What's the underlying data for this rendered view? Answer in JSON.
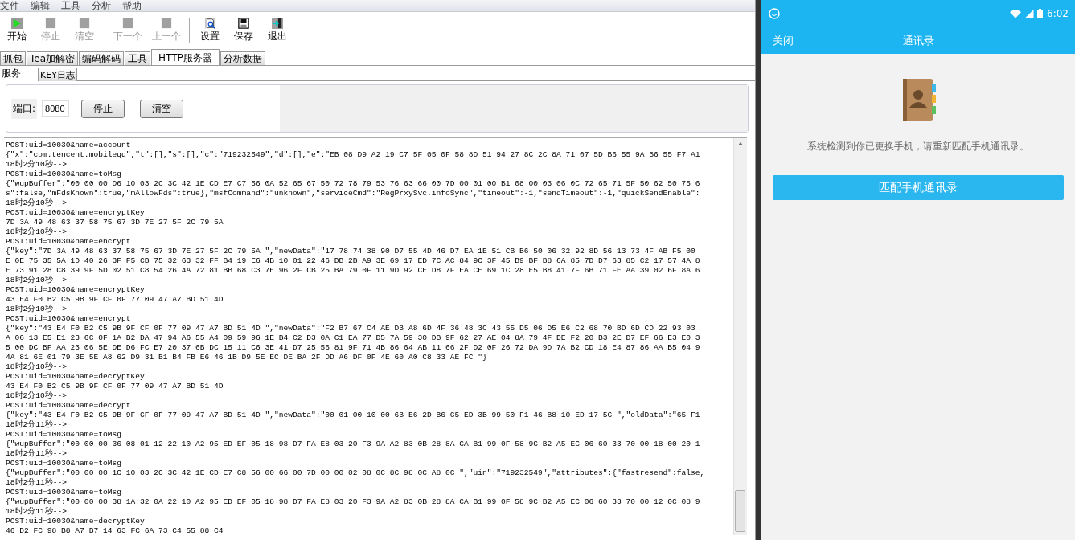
{
  "menu": [
    "文件",
    "编辑",
    "工具",
    "分析",
    "帮助"
  ],
  "toolbar": {
    "groups": [
      [
        {
          "label": "开始",
          "disabled": false
        },
        {
          "label": "停止",
          "disabled": true
        },
        {
          "label": "清空",
          "disabled": true
        }
      ],
      [
        {
          "label": "下一个",
          "disabled": true
        },
        {
          "label": "上一个",
          "disabled": true
        }
      ],
      [
        {
          "label": "设置",
          "disabled": false
        },
        {
          "label": "保存",
          "disabled": false
        },
        {
          "label": "退出",
          "disabled": false
        }
      ]
    ]
  },
  "tabs": [
    {
      "label": "抓包",
      "selected": false
    },
    {
      "label": "Tea加解密",
      "selected": false
    },
    {
      "label": "编码解码",
      "selected": false
    },
    {
      "label": "工具",
      "selected": false
    },
    {
      "label": "HTTP服务器",
      "selected": true
    },
    {
      "label": "分析数据",
      "selected": false
    }
  ],
  "subtabs": [
    {
      "label": "服务",
      "selected": true
    },
    {
      "label": "KEY日志",
      "selected": false
    }
  ],
  "server": {
    "port_label": "端口:",
    "port": "8080",
    "buttons": [
      "停止",
      "清空"
    ]
  },
  "log": [
    "POST:uid=10030&name=account",
    "{\"x\":\"com.tencent.mobileqq\",\"t\":[],\"s\":[],\"c\":\"719232549\",\"d\":[],\"e\":\"EB 08 D9 A2 19 C7 5F 05 0F 58 8D 51 94 27 8C 2C 8A 71 07 5D B6 55 9A B6 55 F7 A1",
    "18时2分10秒-->",
    "POST:uid=10030&name=toMsg",
    "{\"wupBuffer\":\"00 00 00 D6 10 03 2C 3C 42 1E CD E7 C7 56 0A 52 65 67 50 72 78 79 53 76 63 66 00 7D 00 01 00 B1 08 00 03 06 0C 72 65 71 5F 50 62 50 75 6",
    "s\":false,\"mFdsKnown\":true,\"mAllowFds\":true},\"msfCommand\":\"unknown\",\"serviceCmd\":\"RegPrxySvc.infoSync\",\"timeout\":-1,\"sendTimeout\":-1,\"quickSendEnable\":",
    "18时2分10秒-->",
    "POST:uid=10030&name=encryptKey",
    "7D 3A 49 48 63 37 58 75 67 3D 7E 27 5F 2C 79 5A",
    "18时2分10秒-->",
    "POST:uid=10030&name=encrypt",
    "{\"key\":\"7D 3A 49 48 63 37 58 75 67 3D 7E 27 5F 2C 79 5A \",\"newData\":\"17 78 74 38 90 D7 55 4D 46 D7 EA 1E 51 CB B6 50 06 32 92 8D 56 13 73 4F AB F5 00",
    "E 0E 75 35 5A 1D 40 26 3F F5 CB 75 32 63 32 FF B4 19 E6 4B 10 01 22 46 DB 2B A9 3E 69 17 ED 7C AC 84 9C 3F 45 B9 BF B8 6A 85 7D D7 63 85 C2 17 57 4A 8",
    "E 73 91 28 C8 39 9F 5D 02 51 C8 54 26 4A 72 81 BB 68 C3 7E 96 2F CB 25 BA 79 0F 11 9D 92 CE D8 7F EA CE 69 1C 28 E5 B8 41 7F 6B 71 FE AA 39 02 6F 8A 6",
    "18时2分10秒-->",
    "POST:uid=10030&name=encryptKey",
    "43 E4 F0 B2 C5 9B 9F CF 0F 77 09 47 A7 BD 51 4D",
    "18时2分10秒-->",
    "POST:uid=10030&name=encrypt",
    "{\"key\":\"43 E4 F0 B2 C5 9B 9F CF 0F 77 09 47 A7 BD 51 4D \",\"newData\":\"F2 B7 67 C4 AE DB A8 6D 4F 36 48 3C 43 55 D5 06 D5 E6 C2 68 70 BD 6D CD 22 93 03",
    "A 06 13 E5 E1 23 6C 0F 1A B2 DA 47 94 A6 55 A4 09 59 96 1E B4 C2 D3 0A C1 EA 77 D5 7A 59 30 DB 9F 62 27 AE 04 8A 79 4F DE F2 20 B3 2E D7 EF 66 E3 E0 3",
    "5 00 DC BF AA 23 06 5E DE D6 FC E7 20 37 6B DC 15 11 C6 3E 41 D7 25 56 81 9F 71 4B 86 64 AB 11 66 2F D2 0F 26 72 DA 9D 7A B2 CD 18 E4 87 86 AA B5 04 9",
    "4A 81 6E 01 79 3E 5E A8 62 D9 31 B1 B4 FB E6 46 1B D9 5E EC DE BA 2F DD A6 DF 0F 4E 60 A0 C8 33 AE FC \"}",
    "18时2分10秒-->",
    "POST:uid=10030&name=decryptKey",
    "43 E4 F0 B2 C5 9B 9F CF 0F 77 09 47 A7 BD 51 4D",
    "18时2分10秒-->",
    "POST:uid=10030&name=decrypt",
    "{\"key\":\"43 E4 F0 B2 C5 9B 9F CF 0F 77 09 47 A7 BD 51 4D \",\"newData\":\"00 01 00 10 00 6B E6 2D B6 C5 ED 3B 99 50 F1 46 B8 10 ED 17 5C \",\"oldData\":\"65 F1",
    "18时2分11秒-->",
    "POST:uid=10030&name=toMsg",
    "{\"wupBuffer\":\"00 00 00 36 08 01 12 22 10 A2 95 ED EF 05 18 98 D7 FA E8 03 20 F3 9A A2 83 0B 28 8A CA B1 99 0F 58 9C B2 A5 EC 06 60 33 70 00 18 00 20 1",
    "18时2分11秒-->",
    "POST:uid=10030&name=toMsg",
    "{\"wupBuffer\":\"00 00 00 1C 10 03 2C 3C 42 1E CD E7 C8 56 00 66 00 7D 00 00 02 08 0C 8C 98 0C A8 0C \",\"uin\":\"719232549\",\"attributes\":{\"fastresend\":false,",
    "18时2分11秒-->",
    "POST:uid=10030&name=toMsg",
    "{\"wupBuffer\":\"00 00 00 38 1A 32 0A 22 10 A2 95 ED EF 05 18 98 D7 FA E8 03 20 F3 9A A2 83 0B 28 8A CA B1 99 0F 58 9C B2 A5 EC 06 60 33 70 00 12 0C 08 9",
    "18时2分11秒-->",
    "POST:uid=10030&name=decryptKey",
    "46 D2 FC 98 B8 A7 B7 14 63 FC 6A 73 C4 55 88 C4"
  ],
  "phone": {
    "time": "6:02",
    "header": {
      "left": "关闭",
      "title": "通讯录"
    },
    "message": "系统检测到你已更换手机，请重新匹配手机通讯录。",
    "button": "匹配手机通讯录"
  }
}
